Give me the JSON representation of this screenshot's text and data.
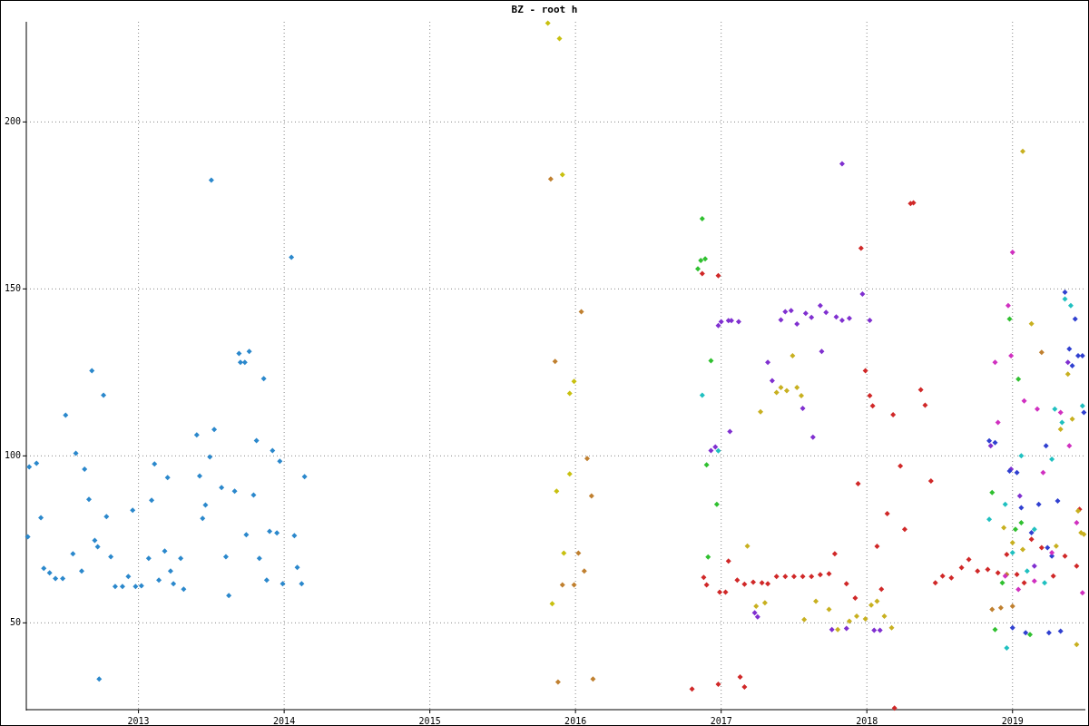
{
  "chart_data": {
    "type": "scatter",
    "title": "BZ - root h",
    "grid": true,
    "xlim": [
      2012.23,
      2019.5
    ],
    "ylim": [
      24,
      230
    ],
    "xticks": [
      {
        "value": 2013,
        "label": "2013"
      },
      {
        "value": 2014,
        "label": "2014"
      },
      {
        "value": 2015,
        "label": "2015"
      },
      {
        "value": 2016,
        "label": "2016"
      },
      {
        "value": 2017,
        "label": "2017"
      },
      {
        "value": 2018,
        "label": "2018"
      },
      {
        "value": 2019,
        "label": "2019"
      }
    ],
    "yticks": [
      50,
      100,
      150,
      200
    ],
    "series": [
      {
        "color": "#2b88cc",
        "x": [
          2012.24,
          2012.25,
          2012.3,
          2012.33,
          2012.35,
          2012.39,
          2012.43,
          2012.48,
          2012.5,
          2012.55,
          2012.57,
          2012.61,
          2012.63,
          2012.66,
          2012.68,
          2012.7,
          2012.72,
          2012.73,
          2012.76,
          2012.78,
          2012.81,
          2012.84,
          2012.89,
          2012.93,
          2012.96,
          2012.98,
          2013.02,
          2013.07,
          2013.09,
          2013.11,
          2013.14,
          2013.18,
          2013.2,
          2013.22,
          2013.24,
          2013.29,
          2013.31,
          2013.4,
          2013.42,
          2013.44,
          2013.46,
          2013.49,
          2013.5,
          2013.52,
          2013.57,
          2013.6,
          2013.62,
          2013.66,
          2013.69,
          2013.7,
          2013.73,
          2013.74,
          2013.76,
          2013.79,
          2013.81,
          2013.83,
          2013.86,
          2013.88,
          2013.9,
          2013.92,
          2013.95,
          2013.97,
          2013.99,
          2014.05,
          2014.07,
          2014.09,
          2014.12,
          2014.14
        ],
        "values": [
          75.8,
          96.7,
          97.8,
          81.5,
          66.3,
          65.0,
          63.3,
          63.3,
          112.2,
          70.7,
          100.8,
          65.5,
          96.0,
          87.0,
          125.5,
          74.7,
          72.8,
          33.2,
          118.2,
          81.8,
          69.8,
          60.9,
          60.9,
          63.9,
          83.7,
          60.9,
          61.1,
          69.3,
          86.7,
          97.6,
          62.8,
          71.5,
          93.5,
          65.5,
          61.7,
          69.3,
          60.1,
          106.3,
          94.0,
          81.3,
          85.3,
          99.7,
          182.6,
          107.9,
          90.5,
          69.8,
          58.2,
          89.4,
          130.7,
          128.0,
          128.0,
          76.4,
          131.3,
          88.3,
          104.6,
          69.3,
          123.1,
          62.8,
          77.4,
          101.6,
          76.9,
          98.4,
          61.7,
          159.5,
          76.1,
          66.6,
          61.7,
          93.8
        ]
      },
      {
        "color": "#c8c010",
        "x": [
          2015.81,
          2015.89,
          2015.91,
          2015.87,
          2015.84,
          2015.96,
          2015.99,
          2015.96,
          2015.92
        ],
        "values": [
          229.6,
          225.0,
          184.2,
          89.4,
          55.7,
          118.7,
          122.3,
          94.6,
          70.9
        ]
      },
      {
        "color": "#c08030",
        "x": [
          2015.83,
          2015.86,
          2015.88,
          2015.91,
          2015.99,
          2016.02,
          2016.04,
          2016.06,
          2016.08,
          2016.11,
          2016.12,
          2018.86,
          2018.92,
          2019.0,
          2018.96,
          2019.2
        ],
        "values": [
          182.9,
          128.3,
          32.3,
          61.4,
          61.4,
          70.9,
          143.2,
          65.5,
          99.2,
          88.0,
          33.2,
          54.0,
          54.5,
          55.0,
          64.5,
          131.0
        ]
      },
      {
        "color": "#d02828",
        "x": [
          2016.88,
          2016.9,
          2016.99,
          2017.03,
          2017.05,
          2017.11,
          2017.16,
          2017.22,
          2017.28,
          2017.32,
          2017.38,
          2017.44,
          2017.5,
          2017.56,
          2017.62,
          2017.68,
          2017.74,
          2017.78,
          2017.86,
          2017.92,
          2017.94,
          2017.96,
          2017.99,
          2018.02,
          2018.04,
          2018.07,
          2018.1,
          2018.14,
          2018.18,
          2018.23,
          2018.26,
          2018.3,
          2018.32,
          2018.37,
          2018.4,
          2018.44,
          2018.47,
          2018.52,
          2018.58,
          2018.65,
          2018.7,
          2018.76,
          2018.83,
          2018.9,
          2018.96,
          2019.03,
          2019.08,
          2019.13,
          2019.2,
          2019.28,
          2019.36,
          2019.44,
          2019.46,
          2018.19,
          2016.8,
          2016.98,
          2017.13,
          2017.16,
          2016.87,
          2016.98
        ],
        "values": [
          63.6,
          61.4,
          59.2,
          59.2,
          68.5,
          62.8,
          61.6,
          62.2,
          62.0,
          61.7,
          63.9,
          63.9,
          63.9,
          63.9,
          63.9,
          64.4,
          64.7,
          70.7,
          61.7,
          57.4,
          91.7,
          162.2,
          125.5,
          118.0,
          115.0,
          72.9,
          60.1,
          82.7,
          112.3,
          97.0,
          78.0,
          175.6,
          175.8,
          119.8,
          115.2,
          92.5,
          62.0,
          64.0,
          63.5,
          66.5,
          69.0,
          65.5,
          66.0,
          65.0,
          70.5,
          64.5,
          62.0,
          75.0,
          72.5,
          64.0,
          70.0,
          67.0,
          84.0,
          24.5,
          30.2,
          31.6,
          33.8,
          30.8,
          154.6,
          154.0
        ]
      },
      {
        "color": "#8030d0",
        "x": [
          2016.93,
          2016.96,
          2016.98,
          2017.0,
          2017.05,
          2017.07,
          2017.12,
          2017.32,
          2017.35,
          2017.41,
          2017.44,
          2017.48,
          2017.52,
          2017.58,
          2017.62,
          2017.68,
          2017.72,
          2017.79,
          2017.83,
          2017.88,
          2017.97,
          2018.02,
          2017.83,
          2017.06,
          2017.23,
          2017.25,
          2017.76,
          2017.86,
          2018.05,
          2018.09,
          2017.69,
          2017.56,
          2017.63,
          2018.99,
          2019.05,
          2018.85,
          2019.38,
          2019.15
        ],
        "values": [
          101.6,
          102.7,
          139.0,
          140.2,
          140.5,
          140.5,
          140.2,
          128.0,
          122.5,
          140.7,
          143.2,
          143.5,
          139.5,
          142.7,
          141.5,
          145.0,
          143.0,
          141.6,
          140.6,
          141.2,
          148.5,
          140.6,
          187.5,
          107.3,
          53.0,
          51.8,
          48.0,
          48.3,
          47.8,
          47.8,
          131.3,
          114.2,
          105.6,
          96.0,
          88.0,
          103.0,
          128.0,
          67.0
        ]
      },
      {
        "color": "#c8b020",
        "x": [
          2017.27,
          2017.38,
          2017.41,
          2017.45,
          2017.49,
          2017.52,
          2017.55,
          2017.18,
          2017.24,
          2017.3,
          2017.57,
          2017.65,
          2017.74,
          2017.8,
          2017.88,
          2017.93,
          2017.99,
          2018.03,
          2018.07,
          2018.12,
          2018.17,
          2018.94,
          2019.0,
          2019.07,
          2019.13,
          2019.3,
          2019.33,
          2019.38,
          2019.41,
          2019.45,
          2019.47,
          2019.49,
          2019.44,
          2019.07
        ],
        "values": [
          113.2,
          119.0,
          120.5,
          119.5,
          130.0,
          120.5,
          118.0,
          73.0,
          55.0,
          56.0,
          51.0,
          56.5,
          54.0,
          48.0,
          50.5,
          52.0,
          51.2,
          55.3,
          56.5,
          52.0,
          48.5,
          78.5,
          74.0,
          72.0,
          139.6,
          73.0,
          108.0,
          124.5,
          111.0,
          83.5,
          77.0,
          76.5,
          43.5,
          191.2
        ]
      },
      {
        "color": "#30c030",
        "x": [
          2016.84,
          2016.86,
          2016.89,
          2016.87,
          2016.91,
          2016.9,
          2016.97,
          2016.93,
          2018.86,
          2018.88,
          2018.98,
          2019.02,
          2019.06,
          2018.93,
          2019.04,
          2019.12
        ],
        "values": [
          156.0,
          158.5,
          159.0,
          171.0,
          69.7,
          97.3,
          85.5,
          128.5,
          89.0,
          48.0,
          141.0,
          78.0,
          80.0,
          62.0,
          123.0,
          46.5
        ]
      },
      {
        "color": "#20c0c0",
        "x": [
          2016.87,
          2016.98,
          2018.84,
          2018.95,
          2019.0,
          2019.06,
          2019.15,
          2019.22,
          2019.29,
          2019.34,
          2019.36,
          2019.4,
          2019.48,
          2018.96,
          2019.1,
          2019.27
        ],
        "values": [
          118.2,
          101.5,
          81.0,
          85.5,
          71.0,
          100.0,
          78.0,
          62.0,
          114.0,
          110.0,
          147.0,
          145.0,
          115.0,
          42.5,
          65.5,
          99.0
        ]
      },
      {
        "color": "#3040d0",
        "x": [
          2018.84,
          2018.88,
          2018.98,
          2019.03,
          2019.06,
          2019.13,
          2019.18,
          2019.24,
          2019.27,
          2019.31,
          2019.36,
          2019.39,
          2019.41,
          2019.43,
          2019.45,
          2019.48,
          2019.49,
          2019.0,
          2019.09,
          2019.25,
          2019.33,
          2019.23
        ],
        "values": [
          104.5,
          104.0,
          95.5,
          95.0,
          84.5,
          77.0,
          85.5,
          72.5,
          70.0,
          86.5,
          149.0,
          132.0,
          127.0,
          141.0,
          130.0,
          130.0,
          113.0,
          48.5,
          47.0,
          47.0,
          47.5,
          103.0
        ]
      },
      {
        "color": "#d030c0",
        "x": [
          2019.0,
          2018.97,
          2018.99,
          2019.08,
          2019.17,
          2019.21,
          2019.27,
          2019.33,
          2019.39,
          2019.44,
          2019.48,
          2019.15,
          2019.04,
          2018.95,
          2018.9,
          2018.88
        ],
        "values": [
          161.0,
          145.0,
          130.0,
          116.5,
          114.0,
          95.0,
          71.0,
          113.0,
          103.0,
          80.0,
          59.0,
          62.5,
          60.0,
          64.0,
          110.0,
          128.0
        ]
      }
    ]
  }
}
